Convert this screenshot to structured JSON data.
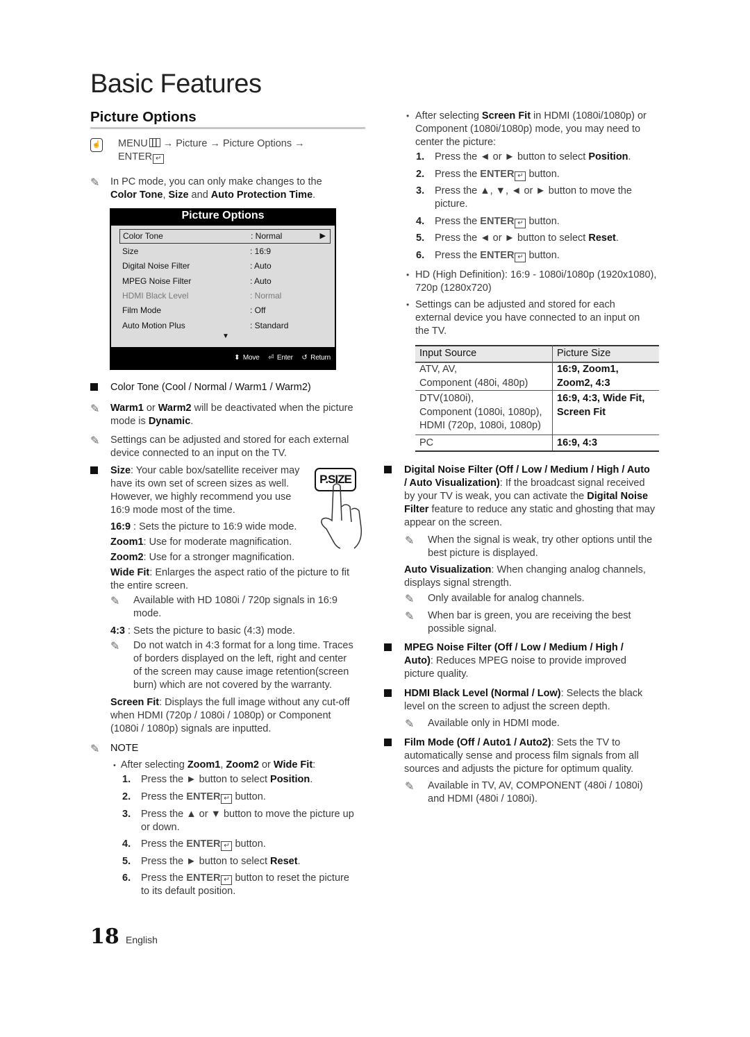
{
  "page": {
    "title": "Basic Features",
    "section_title": "Picture Options",
    "page_number": "18",
    "language": "English"
  },
  "menu_path": {
    "icon": "remote-hand-icon",
    "line1": "MENU",
    "path": " → Picture → Picture Options →",
    "line2": "ENTER"
  },
  "left": {
    "pc_note": {
      "pre": "In PC mode, you can only make changes to the",
      "b1": "Color Tone",
      "sep1": ", ",
      "b2": "Size",
      "sep2": " and ",
      "b3": "Auto Protection Time",
      "end": "."
    },
    "osd": {
      "title": "Picture Options",
      "rows": [
        {
          "label": "Color Tone",
          "value": ": Normal",
          "selected": true
        },
        {
          "label": "Size",
          "value": ": 16:9"
        },
        {
          "label": "Digital Noise Filter",
          "value": ": Auto"
        },
        {
          "label": "MPEG Noise Filter",
          "value": ": Auto"
        },
        {
          "label": "HDMI Black Level",
          "value": ": Normal",
          "disabled": true
        },
        {
          "label": "Film Mode",
          "value": ": Off"
        },
        {
          "label": "Auto Motion Plus",
          "value": ": Standard"
        }
      ],
      "footer": {
        "move": "Move",
        "enter": "Enter",
        "return": "Return"
      }
    },
    "color_tone": {
      "heading": "Color Tone (Cool / Normal / Warm1 / Warm2)",
      "note1_b1": "Warm1",
      "note1_mid": " or ",
      "note1_b2": "Warm2",
      "note1_rest": " will be deactivated when the picture",
      "note1_line2": "mode is ",
      "note1_b3": "Dynamic",
      "note1_end": ".",
      "note2_line1": "Settings can be adjusted and stored for each external",
      "note2_line2": "device connected to an input on the TV."
    },
    "size": {
      "label": "Size",
      "line1": ": Your cable box/satellite receiver may",
      "line2": "have its own set of screen sizes as well.",
      "line3": "However, we highly recommend you use",
      "line4": "16:9 mode most of the time.",
      "psize_button": "P.SIZE",
      "modes": [
        {
          "name": "16:9",
          "desc": " : Sets the picture to 16:9 wide mode."
        },
        {
          "name": "Zoom1",
          "desc": ": Use for moderate magnification."
        },
        {
          "name": "Zoom2",
          "desc": ": Use for a stronger magnification."
        },
        {
          "name": "Wide Fit",
          "desc": ": Enlarges the aspect ratio of the picture to fit",
          "desc2": "the entire screen."
        }
      ],
      "widefit_note1": "Available with HD 1080i / 720p signals in 16:9",
      "widefit_note2": "mode.",
      "mode43_name": "4:3",
      "mode43_desc": " : Sets the picture to basic (4:3) mode.",
      "mode43_note": [
        "Do not watch in 4:3 format for a long time. Traces",
        "of borders displayed on the left, right and center",
        "of the screen may cause image retention(screen",
        "burn) which are not covered by the warranty."
      ],
      "screenfit_name": "Screen Fit",
      "screenfit_desc": [
        ": Displays the full image without any cut-off",
        "when HDMI (720p / 1080i / 1080p) or Component",
        "(1080i / 1080p) signals are inputted."
      ]
    },
    "note": {
      "heading": "NOTE",
      "bullet_pre": "After selecting ",
      "bullet_b1": "Zoom1",
      "bullet_sep1": ", ",
      "bullet_b2": "Zoom2",
      "bullet_sep2": " or ",
      "bullet_b3": "Wide Fit",
      "bullet_end": ":",
      "steps": [
        {
          "num": "1.",
          "pre": "Press the ► button to select ",
          "bold": "Position",
          "post": "."
        },
        {
          "num": "2.",
          "pre": "Press the ",
          "enter": "ENTER",
          "post": " button."
        },
        {
          "num": "3.",
          "pre": "Press the ▲ or ▼ button to move the picture up",
          "line2": "or down."
        },
        {
          "num": "4.",
          "pre": "Press the ",
          "enter": "ENTER",
          "post": " button."
        },
        {
          "num": "5.",
          "pre": "Press the ► button to select ",
          "bold": "Reset",
          "post": "."
        },
        {
          "num": "6.",
          "pre": "Press the ",
          "enter": "ENTER",
          "post": " button to reset the picture",
          "line2": "to its default position."
        }
      ]
    }
  },
  "right": {
    "screenfit_bullet": {
      "pre": "After selecting ",
      "bold": "Screen Fit",
      "post": " in HDMI (1080i/1080p) or",
      "line2": "Component (1080i/1080p) mode, you may need to",
      "line3": "center the picture:",
      "steps": [
        {
          "num": "1.",
          "pre": "Press the ◄ or ► button to select ",
          "bold": "Position",
          "post": "."
        },
        {
          "num": "2.",
          "pre": "Press the ",
          "enter": "ENTER",
          "post": " button."
        },
        {
          "num": "3.",
          "pre": "Press the ▲, ▼, ◄ or ► button to move the",
          "line2": "picture."
        },
        {
          "num": "4.",
          "pre": "Press the ",
          "enter": "ENTER",
          "post": " button."
        },
        {
          "num": "5.",
          "pre": "Press the ◄ or ► button to select ",
          "bold": "Reset",
          "post": "."
        },
        {
          "num": "6.",
          "pre": "Press the ",
          "enter": "ENTER",
          "post": " button."
        }
      ]
    },
    "hd_bullet": [
      "HD (High Definition): 16:9 - 1080i/1080p (1920x1080),",
      "720p (1280x720)"
    ],
    "settings_bullet": [
      "Settings can be adjusted and stored for each",
      "external device you have connected to an input on",
      "the TV."
    ],
    "table": {
      "headers": [
        "Input Source",
        "Picture Size"
      ],
      "rows": [
        {
          "source": [
            "ATV, AV,",
            "Component (480i, 480p)"
          ],
          "sizes": [
            "16:9, Zoom1,",
            "Zoom2, 4:3"
          ]
        },
        {
          "source": [
            "DTV(1080i),",
            "Component (1080i, 1080p),",
            "HDMI (720p, 1080i, 1080p)"
          ],
          "sizes": [
            "16:9, 4:3, Wide Fit,",
            "Screen Fit"
          ]
        },
        {
          "source": [
            "PC"
          ],
          "sizes": [
            "16:9, 4:3"
          ]
        }
      ]
    },
    "dnf": {
      "heading1": "Digital Noise Filter (Off / Low / Medium / High / Auto",
      "heading2": "/ Auto Visualization)",
      "desc1": ": If the broadcast signal received",
      "desc2_pre": "by your TV is weak, you can activate the ",
      "desc2_b": "Digital Noise",
      "desc3_b": "Filter",
      "desc3_post": " feature to reduce any static and ghosting that may",
      "desc4": "appear on the screen.",
      "note1": [
        "When the signal is weak, try other options until the",
        "best picture is displayed."
      ],
      "av_name": "Auto Visualization",
      "av_desc1": ": When changing analog channels,",
      "av_desc2": "displays signal strength.",
      "av_note1": "Only available for analog channels.",
      "av_note2": [
        "When bar is green, you are receiving the best",
        "possible signal."
      ]
    },
    "mpeg": {
      "heading1": "MPEG Noise Filter (Off / Low / Medium / High /",
      "heading2": "Auto)",
      "desc1": ": Reduces MPEG noise to provide improved",
      "desc2": "picture quality."
    },
    "hdmi": {
      "heading": "HDMI Black Level (Normal / Low)",
      "desc1": ": Selects the black",
      "desc2": "level on the screen to adjust the screen depth.",
      "note": "Available only in HDMI mode."
    },
    "film": {
      "heading": "Film Mode (Off / Auto1 / Auto2)",
      "desc1": ": Sets the TV to",
      "desc2": "automatically sense and process film signals from all",
      "desc3": "sources and adjusts the picture for optimum quality.",
      "note": [
        "Available in TV, AV, COMPONENT (480i / 1080i)",
        "and HDMI (480i / 1080i)."
      ]
    }
  }
}
